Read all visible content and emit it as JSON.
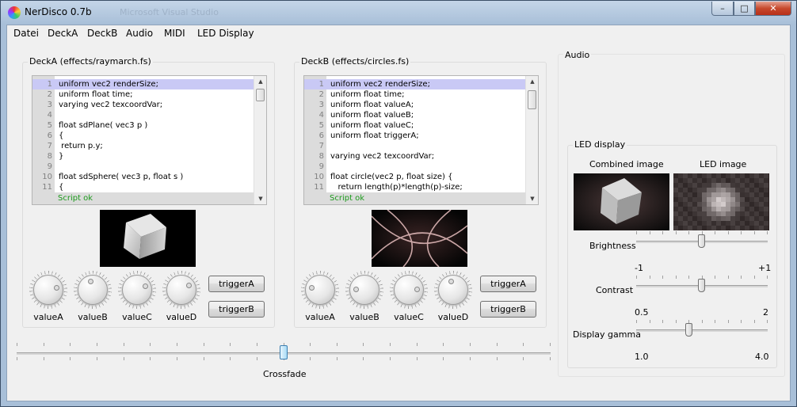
{
  "window": {
    "title": "NerDisco 0.7b",
    "ghost_title": "Microsoft Visual Studio",
    "minimize": "–",
    "maximize": "□",
    "close": "✕"
  },
  "menu": [
    "Datei",
    "DeckA",
    "DeckB",
    "Audio",
    "MIDI",
    "LED Display"
  ],
  "deckA": {
    "title": "DeckA (effects/raymarch.fs)",
    "lines": [
      {
        "n": "1",
        "t": "uniform vec2 renderSize;"
      },
      {
        "n": "2",
        "t": "uniform float time;"
      },
      {
        "n": "3",
        "t": "varying vec2 texcoordVar;"
      },
      {
        "n": "4",
        "t": ""
      },
      {
        "n": "5",
        "t": "float sdPlane( vec3 p )"
      },
      {
        "n": "6",
        "t": "{"
      },
      {
        "n": "7",
        "t": " return p.y;"
      },
      {
        "n": "8",
        "t": "}"
      },
      {
        "n": "9",
        "t": ""
      },
      {
        "n": "10",
        "t": "float sdSphere( vec3 p, float s )"
      },
      {
        "n": "11",
        "t": "{"
      }
    ],
    "status": "Script ok",
    "knobs": [
      "valueA",
      "valueB",
      "valueC",
      "valueD"
    ],
    "knob_values": [
      0.78,
      0.45,
      0.75,
      0.72
    ],
    "triggerA": "triggerA",
    "triggerB": "triggerB"
  },
  "deckB": {
    "title": "DeckB (effects/circles.fs)",
    "lines": [
      {
        "n": "1",
        "t": "uniform vec2 renderSize;"
      },
      {
        "n": "2",
        "t": "uniform float time;"
      },
      {
        "n": "3",
        "t": "uniform float valueA;"
      },
      {
        "n": "4",
        "t": "uniform float valueB;"
      },
      {
        "n": "5",
        "t": "uniform float valueC;"
      },
      {
        "n": "6",
        "t": "uniform float triggerA;"
      },
      {
        "n": "7",
        "t": ""
      },
      {
        "n": "8",
        "t": "varying vec2 texcoordVar;"
      },
      {
        "n": "9",
        "t": ""
      },
      {
        "n": "10",
        "t": "float circle(vec2 p, float size) {"
      },
      {
        "n": "11",
        "t": "   return length(p)*length(p)-size;"
      }
    ],
    "status": "Script ok",
    "knobs": [
      "valueA",
      "valueB",
      "valueC",
      "valueD"
    ],
    "knob_values": [
      0.22,
      0.18,
      0.82,
      0.45
    ],
    "triggerA": "triggerA",
    "triggerB": "triggerB"
  },
  "crossfade": {
    "label": "Crossfade",
    "value": 0.5
  },
  "audio": {
    "title": "Audio"
  },
  "led": {
    "title": "LED display",
    "combined_label": "Combined image",
    "led_label": "LED image",
    "brightness": {
      "label": "Brightness",
      "min": "-1",
      "max": "+1",
      "value": 0.5
    },
    "contrast": {
      "label": "Contrast",
      "min": "0.5",
      "max": "2",
      "value": 0.5
    },
    "gamma": {
      "label": "Display gamma",
      "min": "1.0",
      "max": "4.0",
      "value": 0.4
    }
  }
}
